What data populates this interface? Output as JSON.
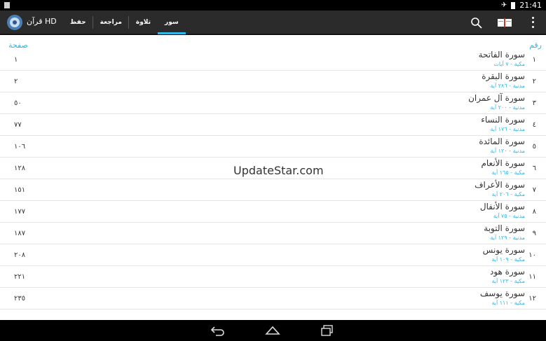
{
  "status": {
    "time": "21:41"
  },
  "app": {
    "title": "قرآن HD"
  },
  "tabs": [
    {
      "label": "سور",
      "active": true
    },
    {
      "label": "تلاوة",
      "active": false
    },
    {
      "label": "مراجعة",
      "active": false
    },
    {
      "label": "حفظ",
      "active": false
    }
  ],
  "list_header": {
    "number": "رقم",
    "page": "صفحة"
  },
  "surahs": [
    {
      "num": "١",
      "name": "سورة الفاتحة",
      "meta": "مكية - ٧ آيات",
      "page": "١"
    },
    {
      "num": "٢",
      "name": "سورة البقرة",
      "meta": "مدنية - ٢٨٦ آية",
      "page": "٢"
    },
    {
      "num": "٣",
      "name": "سورة آل عمران",
      "meta": "مدنية - ٢٠٠ آية",
      "page": "٥٠"
    },
    {
      "num": "٤",
      "name": "سورة النساء",
      "meta": "مدنية - ١٧٦ آية",
      "page": "٧٧"
    },
    {
      "num": "٥",
      "name": "سورة المائدة",
      "meta": "مدنية - ١٢٠ آية",
      "page": "١٠٦"
    },
    {
      "num": "٦",
      "name": "سورة الأنعام",
      "meta": "مكية - ١٦٥ آية",
      "page": "١٢٨"
    },
    {
      "num": "٧",
      "name": "سورة الأعراف",
      "meta": "مكية - ٢٠٦ آية",
      "page": "١٥١"
    },
    {
      "num": "٨",
      "name": "سورة الأنفال",
      "meta": "مدنية - ٧٥ آية",
      "page": "١٧٧"
    },
    {
      "num": "٩",
      "name": "سورة التوبة",
      "meta": "مدنية - ١٢٩ آية",
      "page": "١٨٧"
    },
    {
      "num": "١٠",
      "name": "سورة يونس",
      "meta": "مكية - ١٠٩ آية",
      "page": "٢٠٨"
    },
    {
      "num": "١١",
      "name": "سورة هود",
      "meta": "مكية - ١٢٣ آية",
      "page": "٢٢١"
    },
    {
      "num": "١٢",
      "name": "سورة يوسف",
      "meta": "مكية - ١١١ آية",
      "page": "٢٣٥"
    }
  ],
  "watermark": "UpdateStar.com",
  "colors": {
    "accent": "#33b5e5",
    "actionbar": "#2b2b2b"
  }
}
